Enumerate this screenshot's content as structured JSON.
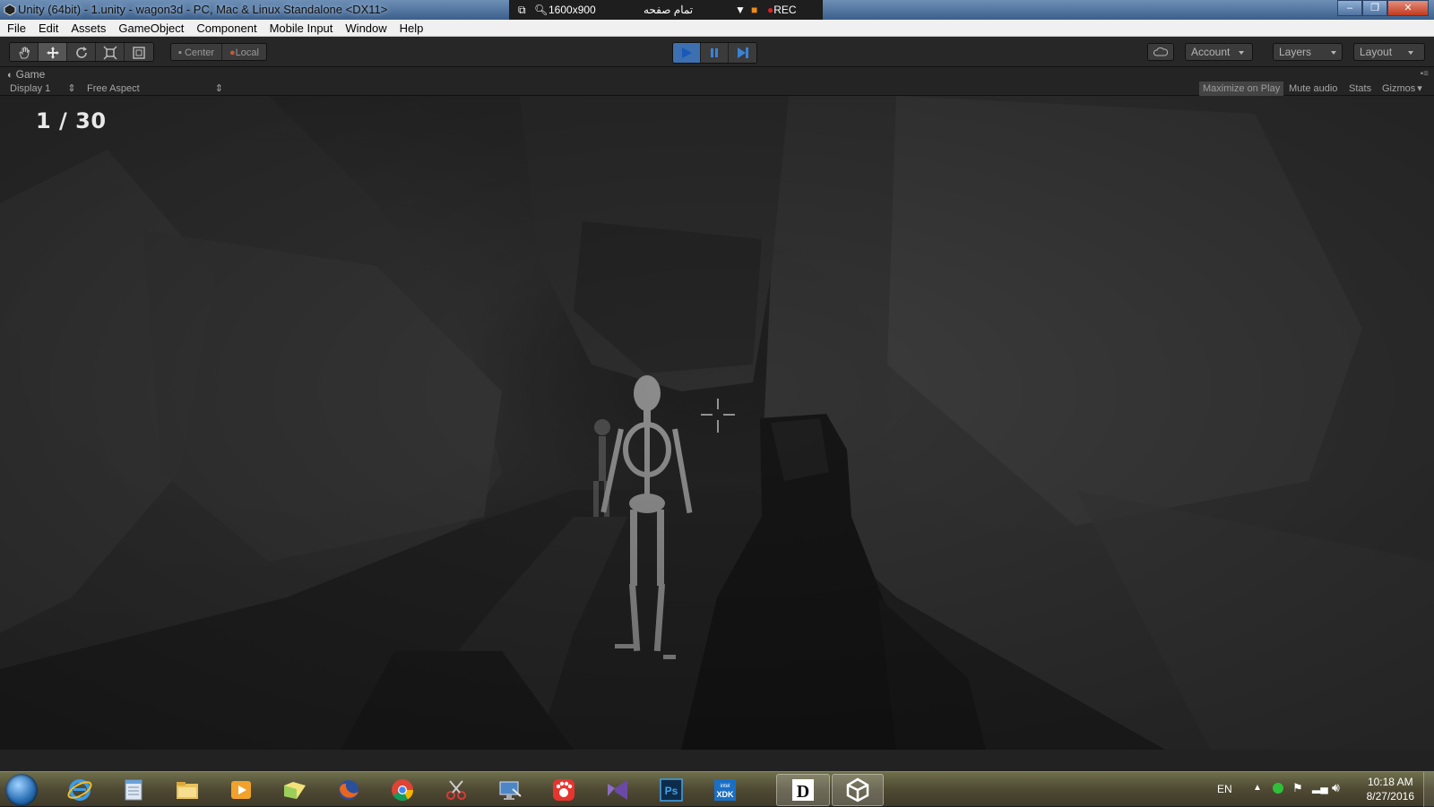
{
  "window": {
    "title": "Unity (64bit) - 1.unity - wagon3d - PC, Mac & Linux Standalone <DX11>",
    "minimize": "‒",
    "maximize": "❐",
    "close": "✕"
  },
  "recorder": {
    "resolution": "1600x900",
    "mode": "تمام صفحه",
    "rec_label": "REC"
  },
  "menu": [
    "File",
    "Edit",
    "Assets",
    "GameObject",
    "Component",
    "Mobile Input",
    "Window",
    "Help"
  ],
  "toolbar": {
    "transform_tools": [
      "hand-icon",
      "move-icon",
      "rotate-icon",
      "scale-icon",
      "rect-icon"
    ],
    "pivot": {
      "center_label": "Center",
      "local_label": "Local"
    },
    "play_controls": [
      "play-icon",
      "pause-icon",
      "step-icon"
    ],
    "account_label": "Account",
    "layers_label": "Layers",
    "layout_label": "Layout"
  },
  "game_panel": {
    "tab_label": "Game",
    "display": "Display 1",
    "aspect": "Free Aspect",
    "maximize_on_play": "Maximize on Play",
    "mute_audio": "Mute audio",
    "stats": "Stats",
    "gizmos": "Gizmos"
  },
  "hud": {
    "counter": "1 / 30"
  },
  "taskbar": {
    "apps": [
      "internet-explorer-icon",
      "notepad-icon",
      "file-explorer-icon",
      "media-player-icon",
      "folder-sync-icon",
      "firefox-icon",
      "chrome-icon",
      "snipping-tool-icon",
      "remote-desktop-icon",
      "paw-app-icon",
      "visual-studio-icon",
      "photoshop-icon",
      "intel-xdk-icon",
      "d-app-icon",
      "unity-icon"
    ],
    "photoshop_label": "Ps",
    "xdk_label": "XDK",
    "xdk_brand": "intel",
    "d_label": "D",
    "language": "EN",
    "time": "10:18 AM",
    "date": "8/27/2016"
  },
  "colors": {
    "play_active": "#3d70b0",
    "taskbar": "#4f4a33"
  }
}
